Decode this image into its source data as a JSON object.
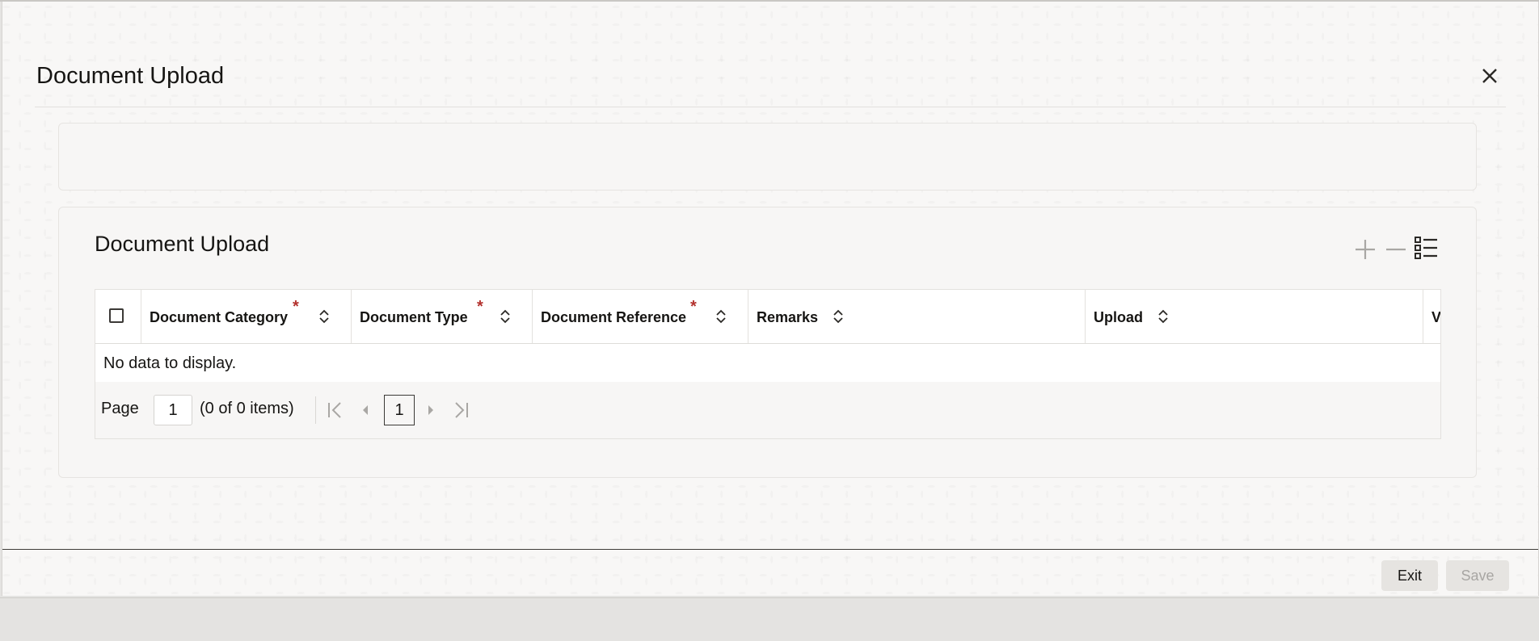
{
  "dialog": {
    "title": "Document Upload",
    "close_icon": "close-icon"
  },
  "section": {
    "title": "Document Upload",
    "toolbar": {
      "add_icon": "plus-icon",
      "remove_icon": "minus-icon",
      "columns_icon": "list-view-icon"
    }
  },
  "table": {
    "columns": [
      {
        "label": "Document Category",
        "required": true
      },
      {
        "label": "Document Type",
        "required": true
      },
      {
        "label": "Document Reference",
        "required": true
      },
      {
        "label": "Remarks",
        "required": false
      },
      {
        "label": "Upload",
        "required": false
      },
      {
        "label": "V",
        "required": false
      }
    ],
    "empty_text": "No data to display."
  },
  "pager": {
    "label": "Page",
    "page_value": "1",
    "info": "(0 of 0 items)",
    "current_page": "1"
  },
  "footer": {
    "exit_label": "Exit",
    "save_label": "Save"
  },
  "colors": {
    "required": "#b3312d",
    "disabled_text": "#a8a6a3"
  }
}
